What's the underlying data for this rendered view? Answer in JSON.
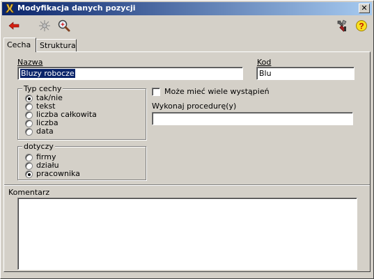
{
  "window": {
    "title": "Modyfikacja danych pozycji",
    "close_glyph": "✕"
  },
  "toolbar": {
    "back_icon": "arrow-left-icon",
    "stop_icon": "sparkle-icon",
    "zoom_icon": "magnifier-icon",
    "tools_icon": "tools-icon",
    "help_icon": "help-icon",
    "help_glyph": "?"
  },
  "tabs": [
    {
      "label": "Cecha",
      "active": true
    },
    {
      "label": "Struktura",
      "active": false
    }
  ],
  "form": {
    "name_label": "Nazwa",
    "name_value": "Bluzy robocze",
    "code_label": "Kod",
    "code_value": "Blu",
    "type_group": {
      "title": "Typ cechy",
      "options": [
        "tak/nie",
        "tekst",
        "liczba całkowita",
        "liczba",
        "data"
      ],
      "selected_index": 0
    },
    "applies_group": {
      "title": "dotyczy",
      "options": [
        "firmy",
        "działu",
        "pracownika"
      ],
      "selected_index": 2
    },
    "multiple_label": "Może mieć wiele wystąpień",
    "multiple_checked": false,
    "procedure_label": "Wykonaj procedurę(y)",
    "procedure_value": "",
    "comment_label": "Komentarz",
    "comment_value": ""
  },
  "colors": {
    "titlebar_start": "#0a246a",
    "titlebar_end": "#a6caf0",
    "face": "#d4d0c8",
    "selection": "#0a246a"
  }
}
